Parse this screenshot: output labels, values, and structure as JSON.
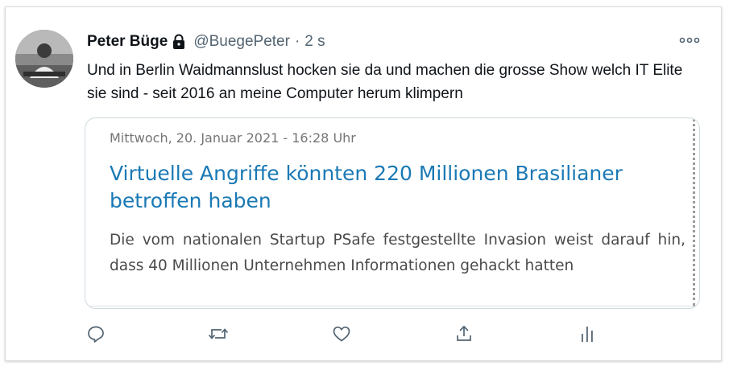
{
  "tweet": {
    "author_name": "Peter Büge",
    "handle": "@BuegePeter",
    "separator": "·",
    "time": "2 s",
    "text": "Und in Berlin Waidmannslust hocken sie da und machen die grosse Show welch IT Elite sie sind - seit 2016 an meine Computer herum klimpern",
    "protected_icon": "lock-icon",
    "more_icon": "more-dots-icon"
  },
  "card": {
    "date": "Mittwoch, 20. Januar 2021 - 16:28 Uhr",
    "title": "Virtuelle Angriffe könnten 220 Millionen Brasilianer betroffen haben",
    "description": "Die vom nationalen Startup PSafe festgestellte Invasion weist darauf hin, dass 40 Millionen Unternehmen Informationen gehackt hatten"
  },
  "actions": [
    "reply-icon",
    "retweet-icon",
    "like-icon",
    "share-icon",
    "analytics-icon"
  ],
  "colors": {
    "text": "#0f1419",
    "muted": "#536471",
    "link": "#1a79b5",
    "icon": "#536471"
  }
}
